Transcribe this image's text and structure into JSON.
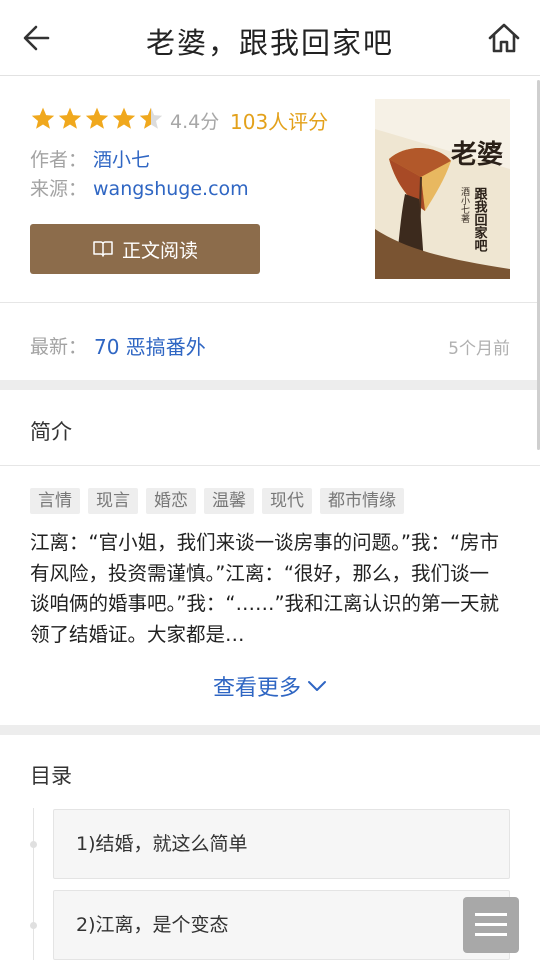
{
  "header": {
    "title": "老婆，跟我回家吧",
    "back_icon": "back-arrow-icon",
    "home_icon": "home-icon"
  },
  "book": {
    "rating": 4.4,
    "rating_stars_max": 5,
    "score_text": "4.4分",
    "rating_count": "103人评分",
    "author_label": "作者：",
    "author": "酒小七",
    "source_label": "来源：",
    "source": "wangshuge.com",
    "read_button": "正文阅读",
    "cover_title": "老婆",
    "cover_subtitle": "跟我回家吧",
    "cover_author": "酒小七著"
  },
  "latest": {
    "label": "最新：",
    "chapter": "70 恶搞番外",
    "time": "5个月前"
  },
  "intro": {
    "title": "简介",
    "tags": [
      "言情",
      "现言",
      "婚恋",
      "温馨",
      "现代",
      "都市情缘"
    ],
    "summary": "江离：“官小姐，我们来谈一谈房事的问题。”我：“房市有风险，投资需谨慎。”江离：“很好，那么，我们谈一谈咱俩的婚事吧。”我：“……”我和江离认识的第一天就领了结婚证。大家都是…",
    "more": "查看更多"
  },
  "toc": {
    "title": "目录",
    "items": [
      "1)结婚，就这么简单",
      "2)江离，是个变态"
    ]
  },
  "colors": {
    "accent_blue": "#2f66c3",
    "rating_orange": "#e3a11b",
    "read_button_brown": "#8c6c4b"
  }
}
